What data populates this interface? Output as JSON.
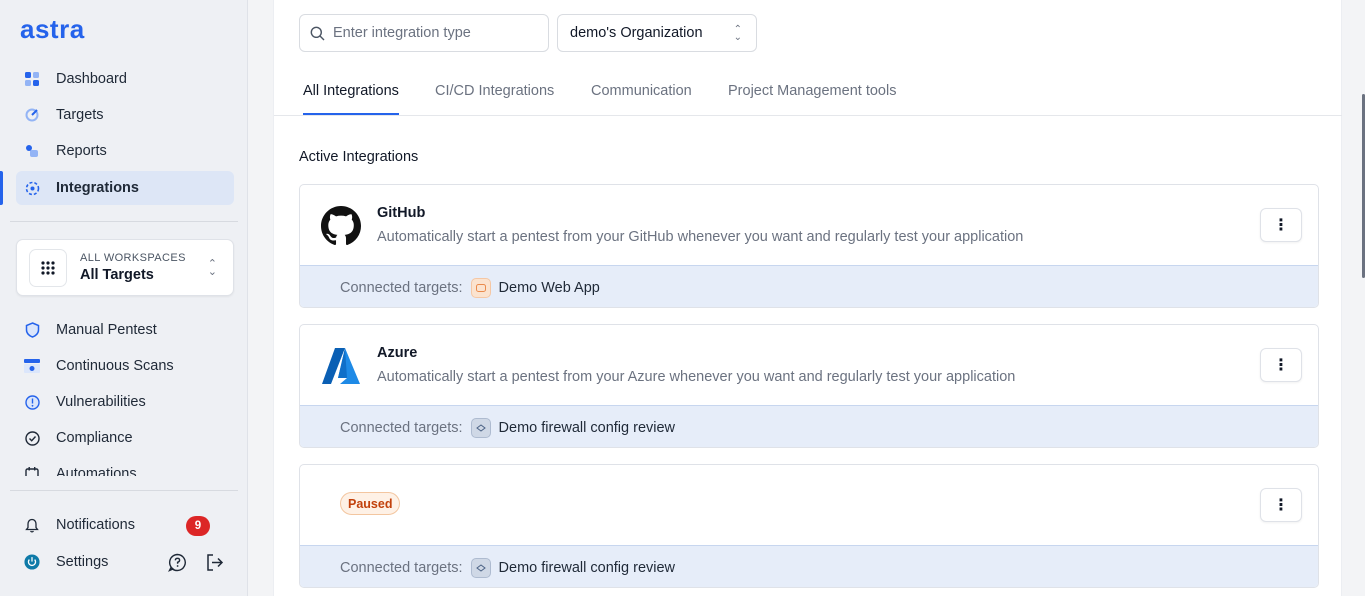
{
  "app": {
    "logo": "astra"
  },
  "sidebar": {
    "top_items": [
      {
        "label": "Dashboard",
        "icon": "dashboard-icon"
      },
      {
        "label": "Targets",
        "icon": "targets-icon"
      },
      {
        "label": "Reports",
        "icon": "reports-icon"
      },
      {
        "label": "Integrations",
        "icon": "integrations-icon",
        "active": true
      }
    ],
    "workspace": {
      "caption": "ALL WORKSPACES",
      "title": "All Targets"
    },
    "lower_items": [
      {
        "label": "Manual Pentest",
        "icon": "shield-icon"
      },
      {
        "label": "Continuous Scans",
        "icon": "scan-icon"
      },
      {
        "label": "Vulnerabilities",
        "icon": "vulnerability-icon"
      },
      {
        "label": "Compliance",
        "icon": "check-circle-icon"
      },
      {
        "label": "Automations",
        "icon": "calendar-icon"
      }
    ],
    "notifications": {
      "label": "Notifications",
      "count": "9"
    },
    "settings": {
      "label": "Settings"
    }
  },
  "toolbar": {
    "search_placeholder": "Enter integration type",
    "org_selected": "demo's Organization"
  },
  "tabs": [
    {
      "label": "All Integrations",
      "active": true
    },
    {
      "label": "CI/CD Integrations"
    },
    {
      "label": "Communication"
    },
    {
      "label": "Project Management tools"
    }
  ],
  "section_title": "Active Integrations",
  "integrations": [
    {
      "name": "GitHub",
      "description": "Automatically start a pentest from your GitHub whenever you want and regularly test your application",
      "connected_label": "Connected targets:",
      "target": "Demo Web App",
      "icon": "github-icon"
    },
    {
      "name": "Azure",
      "description": "Automatically start a pentest from your Azure whenever you want and regularly test your application",
      "connected_label": "Connected targets:",
      "target": "Demo firewall config review",
      "icon": "azure-icon"
    },
    {
      "status": "Paused",
      "connected_label": "Connected targets:",
      "target": "Demo firewall config review"
    }
  ],
  "colors": {
    "accent": "#2563eb",
    "badge": "#dc2626",
    "paused": "#c2410c"
  }
}
